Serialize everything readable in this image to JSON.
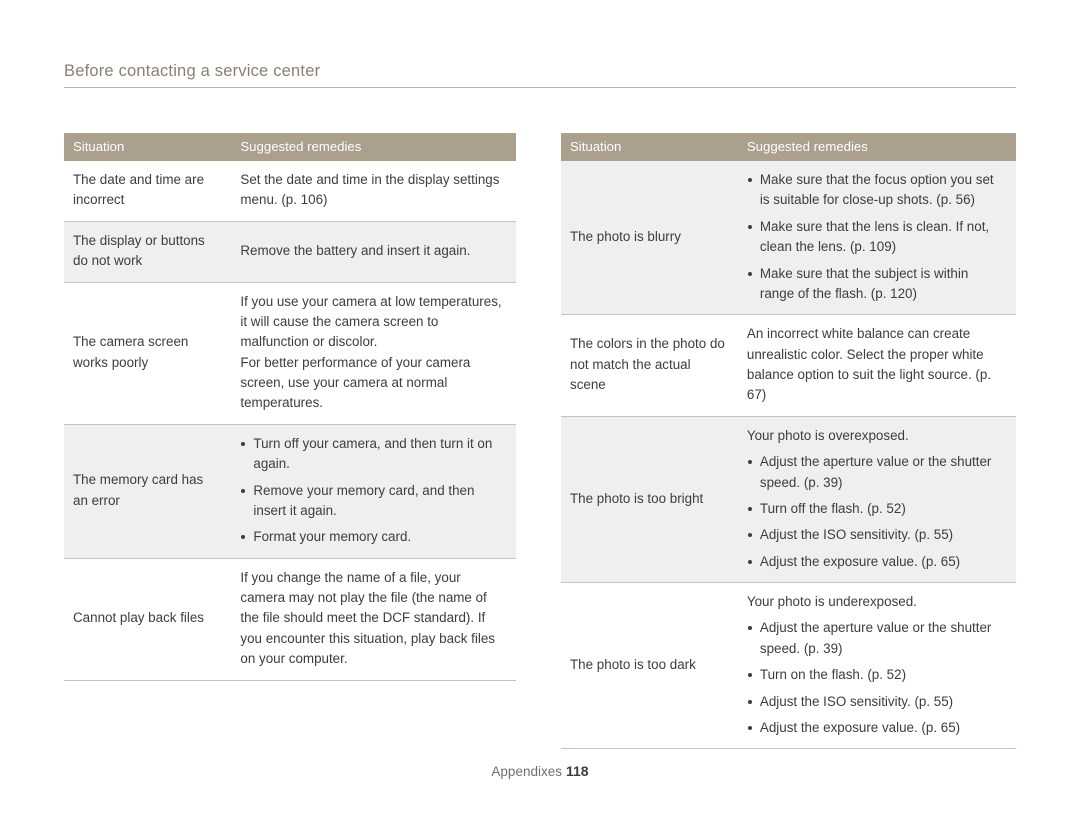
{
  "header": {
    "title": "Before contacting a service center"
  },
  "left_table": {
    "columns": [
      "Situation",
      "Suggested remedies"
    ],
    "rows": [
      {
        "situation": "The date and time are incorrect",
        "remedy_type": "text",
        "remedy": "Set the date and time in the display settings menu. (p. 106)",
        "shaded": false
      },
      {
        "situation": "The display or buttons do not work",
        "remedy_type": "text",
        "remedy": "Remove the battery and insert it again.",
        "shaded": true
      },
      {
        "situation": "The camera screen works poorly",
        "remedy_type": "paragraphs",
        "remedy_paragraphs": [
          "If you use your camera at low temperatures, it will cause the camera screen to malfunction or discolor.",
          "For better performance of your camera screen, use your camera at normal temperatures."
        ],
        "shaded": false
      },
      {
        "situation": "The memory card has an error",
        "remedy_type": "bullets",
        "remedy_bullets": [
          "Turn off your camera, and then turn it on again.",
          "Remove your memory card, and then insert it again.",
          "Format your memory card."
        ],
        "shaded": true
      },
      {
        "situation": "Cannot play back files",
        "remedy_type": "text",
        "remedy": "If you change the name of a file, your camera may not play the file (the name of the file should meet the DCF standard). If you encounter this situation, play back files on your computer.",
        "shaded": false
      }
    ]
  },
  "right_table": {
    "columns": [
      "Situation",
      "Suggested remedies"
    ],
    "rows": [
      {
        "situation": "The photo is blurry",
        "remedy_type": "bullets",
        "remedy_bullets": [
          "Make sure that the focus option you set is suitable for close-up shots. (p. 56)",
          "Make sure that the lens is clean. If not, clean the lens. (p. 109)",
          "Make sure that the subject is within range of the flash. (p. 120)"
        ],
        "shaded": true
      },
      {
        "situation": "The colors in the photo do not match the actual scene",
        "remedy_type": "text",
        "remedy": "An incorrect white balance can create unrealistic color. Select the proper white balance option to suit the light source. (p. 67)",
        "shaded": false
      },
      {
        "situation": "The photo is too bright",
        "remedy_type": "lead_bullets",
        "remedy_lead": "Your photo is overexposed.",
        "remedy_bullets": [
          "Adjust the aperture value or the shutter speed. (p. 39)",
          "Turn off the flash. (p. 52)",
          "Adjust the ISO sensitivity. (p. 55)",
          "Adjust the exposure value. (p. 65)"
        ],
        "shaded": true
      },
      {
        "situation": "The photo is too dark",
        "remedy_type": "lead_bullets",
        "remedy_lead": "Your photo is underexposed.",
        "remedy_bullets": [
          "Adjust the aperture value or the shutter speed. (p. 39)",
          "Turn on the flash. (p. 52)",
          "Adjust the ISO sensitivity. (p. 55)",
          "Adjust the exposure value. (p. 65)"
        ],
        "shaded": false
      }
    ]
  },
  "footer": {
    "label": "Appendixes",
    "page": "118"
  },
  "colors": {
    "header_text": "#8a7f6e",
    "table_header_bg": "#ab9f8e",
    "shaded_row_bg": "#efefef",
    "border": "#c9c2b7"
  }
}
